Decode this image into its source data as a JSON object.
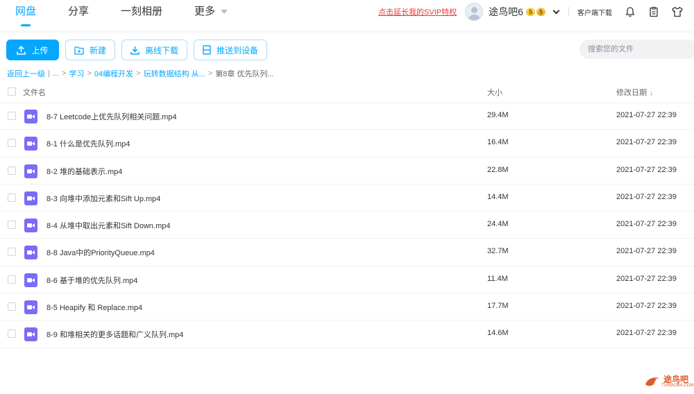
{
  "nav": {
    "items": [
      "网盘",
      "分享",
      "一刻相册",
      "更多"
    ],
    "active": "网盘"
  },
  "header": {
    "svip_link": "点击延长我的SVIP特权",
    "username": "途鸟吧6",
    "badges": [
      "5",
      "5"
    ],
    "client_download": "客户端下载",
    "icons": [
      "bell-icon",
      "clipboard-icon",
      "shirt-icon"
    ]
  },
  "toolbar": {
    "upload": "上传",
    "new": "新建",
    "offline_download": "离线下载",
    "push_device": "推送到设备"
  },
  "search": {
    "placeholder": "搜索您的文件"
  },
  "breadcrumb": {
    "back": "返回上一级",
    "ellipsis": "...",
    "items": [
      "学习",
      "04编程开发",
      "玩转数据结构 从..."
    ],
    "current": "第8章 优先队列..."
  },
  "table": {
    "headers": {
      "name": "文件名",
      "size": "大小",
      "date": "修改日期"
    },
    "rows": [
      {
        "name": "8-7 Leetcode上优先队列相关问题.mp4",
        "size": "29.4M",
        "date": "2021-07-27 22:39"
      },
      {
        "name": "8-1 什么是优先队列.mp4",
        "size": "16.4M",
        "date": "2021-07-27 22:39"
      },
      {
        "name": "8-2 堆的基础表示.mp4",
        "size": "22.8M",
        "date": "2021-07-27 22:39"
      },
      {
        "name": "8-3 向堆中添加元素和Sift Up.mp4",
        "size": "14.4M",
        "date": "2021-07-27 22:39"
      },
      {
        "name": "8-4 从堆中取出元素和Sift Down.mp4",
        "size": "24.4M",
        "date": "2021-07-27 22:39"
      },
      {
        "name": "8-8 Java中的PriorityQueue.mp4",
        "size": "32.7M",
        "date": "2021-07-27 22:39"
      },
      {
        "name": "8-6 基于堆的优先队列.mp4",
        "size": "11.4M",
        "date": "2021-07-27 22:39"
      },
      {
        "name": "8-5 Heapify 和 Replace.mp4",
        "size": "17.7M",
        "date": "2021-07-27 22:39"
      },
      {
        "name": "8-9 和堆相关的更多话题和广义队列.mp4",
        "size": "14.6M",
        "date": "2021-07-27 22:39"
      }
    ]
  },
  "watermark": {
    "text": "途鸟吧",
    "sub": "TUNIAOBA.COM"
  },
  "colors": {
    "accent": "#06a7ff",
    "video_icon": "#7b6cf6",
    "svip": "#e83a3a"
  }
}
